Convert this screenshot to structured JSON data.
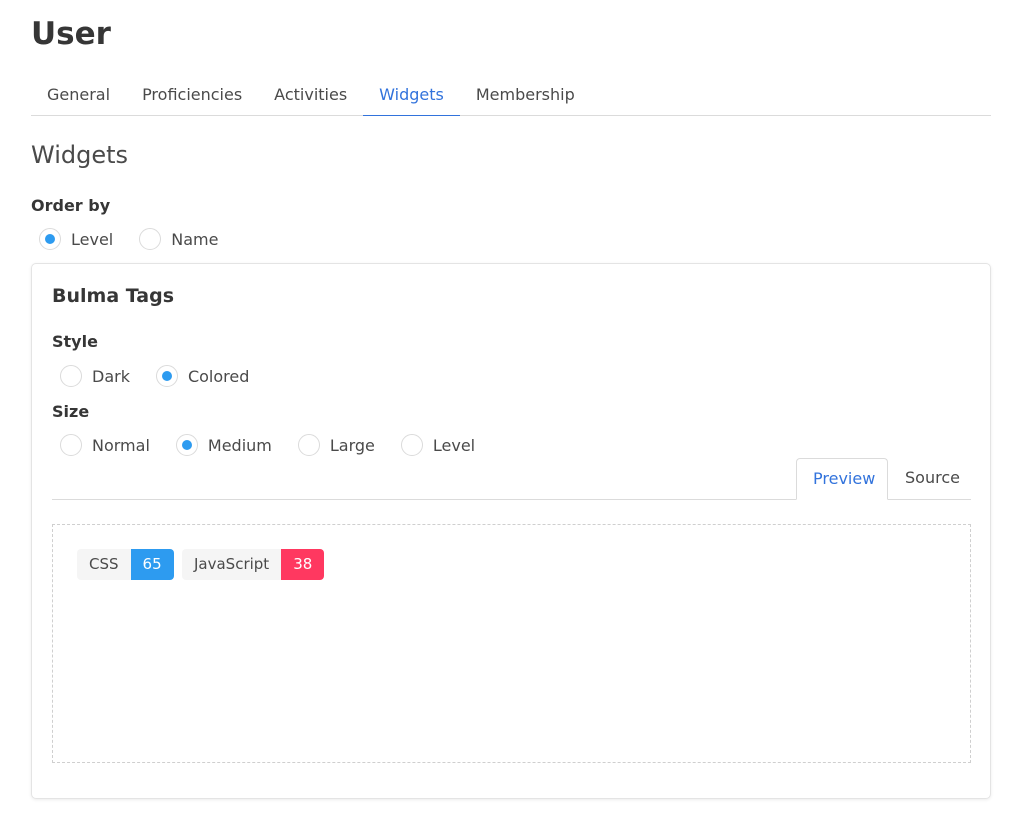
{
  "page": {
    "title": "User"
  },
  "tabs": [
    {
      "label": "General",
      "active": false
    },
    {
      "label": "Proficiencies",
      "active": false
    },
    {
      "label": "Activities",
      "active": false
    },
    {
      "label": "Widgets",
      "active": true
    },
    {
      "label": "Membership",
      "active": false
    }
  ],
  "section": {
    "title": "Widgets"
  },
  "order_by": {
    "label": "Order by",
    "options": [
      {
        "label": "Level",
        "checked": true
      },
      {
        "label": "Name",
        "checked": false
      }
    ]
  },
  "card": {
    "title": "Bulma Tags",
    "style": {
      "label": "Style",
      "options": [
        {
          "label": "Dark",
          "checked": false
        },
        {
          "label": "Colored",
          "checked": true
        }
      ]
    },
    "size": {
      "label": "Size",
      "options": [
        {
          "label": "Normal",
          "checked": false
        },
        {
          "label": "Medium",
          "checked": true
        },
        {
          "label": "Large",
          "checked": false
        },
        {
          "label": "Level",
          "checked": false
        }
      ]
    },
    "view_tabs": [
      {
        "label": "Preview",
        "active": true
      },
      {
        "label": "Source",
        "active": false
      }
    ],
    "tags": [
      {
        "name": "CSS",
        "value": "65",
        "color": "#2d9bf0"
      },
      {
        "name": "JavaScript",
        "value": "38",
        "color": "#ff3860"
      }
    ]
  },
  "colors": {
    "accent": "#3273dc",
    "radio_checked": "#2d9bf0"
  }
}
